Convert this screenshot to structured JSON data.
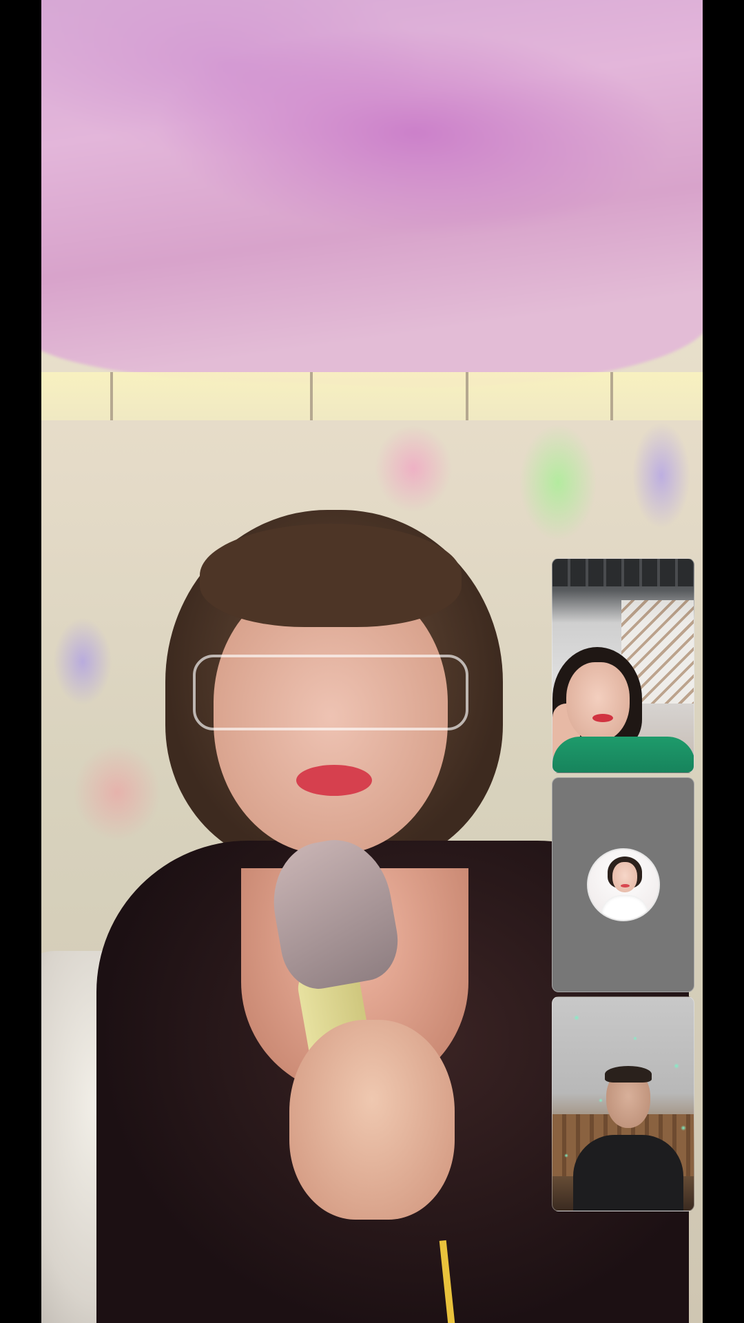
{
  "screen": {
    "type": "video-call",
    "background_color": "#000000"
  },
  "main_video": {
    "description_icon": "live-video-feed"
  },
  "participants": [
    {
      "tile": "participant-video-1",
      "state": "video-on"
    },
    {
      "tile": "participant-avatar-2",
      "state": "video-off",
      "icon": "profile-avatar"
    },
    {
      "tile": "participant-video-3",
      "state": "video-on"
    }
  ],
  "colors": {
    "tile_off_background": "#777777",
    "tile_border": "#ffffff"
  }
}
